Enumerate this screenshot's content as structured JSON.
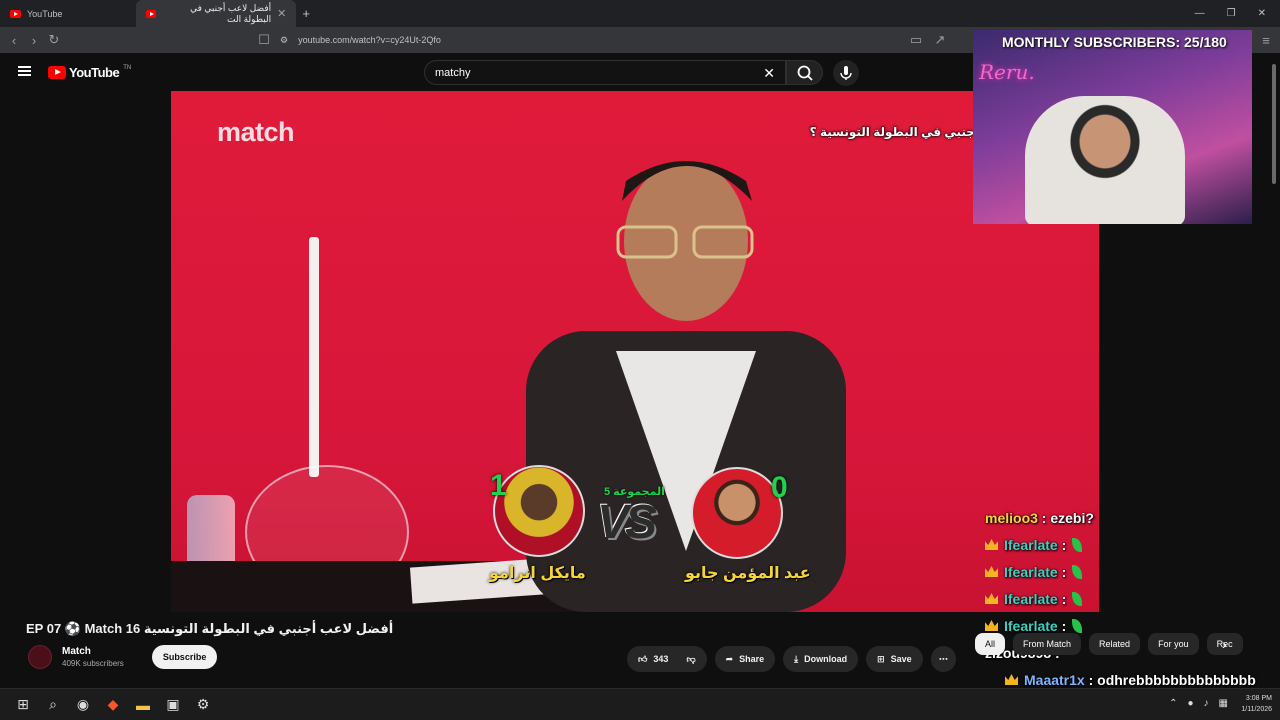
{
  "browser": {
    "tabs": [
      {
        "label": "YouTube"
      },
      {
        "label": "أفضل لاعب أجنبي في البطولة الت",
        "active": true
      }
    ],
    "url": "youtube.com/watch?v=cy24Ut-2Qfo"
  },
  "youtube": {
    "logo_text": "YouTube",
    "logo_region": "TN",
    "search_value": "matchy"
  },
  "video": {
    "watermark": "match",
    "overlay_question": "جنبي في البطولة التونسية ؟",
    "group_label": "المجموعة 5",
    "left_player": {
      "name": "مايكل انرامو",
      "score": "1"
    },
    "right_player": {
      "name": "عبد المؤمن جابو",
      "score": "0"
    },
    "vs": "VS"
  },
  "stream": {
    "overlay_title": "MONTHLY SUBSCRIBERS: 25/180",
    "signature": "Reru."
  },
  "chat": [
    {
      "user": "melioo3",
      "message": ": ezebi?",
      "color": "#f7d33a",
      "badge": ""
    },
    {
      "user": "Ifearlate",
      "message": ":",
      "color": "#3ad1c2",
      "badge": "crown"
    },
    {
      "user": "Ifearlate",
      "message": ":",
      "color": "#3ad1c2",
      "badge": "crown"
    },
    {
      "user": "Ifearlate",
      "message": ":",
      "color": "#3ad1c2",
      "badge": "crown"
    },
    {
      "user": "Ifearlate",
      "message": ":",
      "color": "#3ad1c2",
      "badge": "crown"
    },
    {
      "user": "zizou9898",
      "message": ":",
      "color": "#ffffff",
      "badge": ""
    },
    {
      "user": "Maaatr1x",
      "message": ": odhrebbbbbbbbbbbbbb",
      "color": "#7db3ff",
      "badge": "crown"
    }
  ],
  "chips": [
    "All",
    "From Match",
    "Related",
    "For you",
    "Rec"
  ],
  "meta": {
    "title": "أفضل لاعب أجنبي في البطولة التونسية EP 07 ⚽ Match 16",
    "channel": "Match",
    "subscribers": "409K subscribers",
    "subscribe_label": "Subscribe",
    "likes": "343",
    "share_label": "Share",
    "download_label": "Download",
    "save_label": "Save"
  },
  "taskbar": {
    "time": "3:08 PM",
    "date": "1/11/2026"
  },
  "colors": {
    "accent": "#ff0000",
    "video_bg": "#d6163a",
    "score": "#1fd14c",
    "player_name": "#f7d33a"
  }
}
